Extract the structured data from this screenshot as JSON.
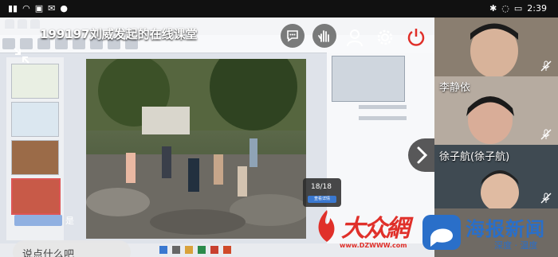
{
  "status_bar": {
    "left_icons": [
      "sim-icon",
      "sim2-icon",
      "wifi-icon",
      "image-icon",
      "mail-icon",
      "chat-icon",
      "chat2-icon"
    ],
    "time": "2:39",
    "right_icons": [
      "bluetooth-icon",
      "nfc-icon",
      "alarm-icon",
      "mute-icon",
      "battery-icon"
    ]
  },
  "meeting": {
    "title": "199197刘威发起的在线课堂"
  },
  "shared_screen": {
    "page_counter": "18/18",
    "page_button": "查看详情"
  },
  "chat": {
    "sender": "",
    "message": "是",
    "input_placeholder": "说点什么吧"
  },
  "participants": [
    {
      "name": "",
      "muted": true
    },
    {
      "name": "李静依",
      "muted": true
    },
    {
      "name": "徐子航(徐子航)",
      "muted": true
    },
    {
      "name": "",
      "muted": false
    }
  ],
  "watermark_left": {
    "brand": "大众網",
    "url": "www.DZWWW.com"
  },
  "watermark_right": {
    "brand": "海报新闻",
    "slogan": "深度 · 温度"
  },
  "colors": {
    "accent_red": "#e0302a",
    "watermark_blue": "#2a6fc9"
  }
}
